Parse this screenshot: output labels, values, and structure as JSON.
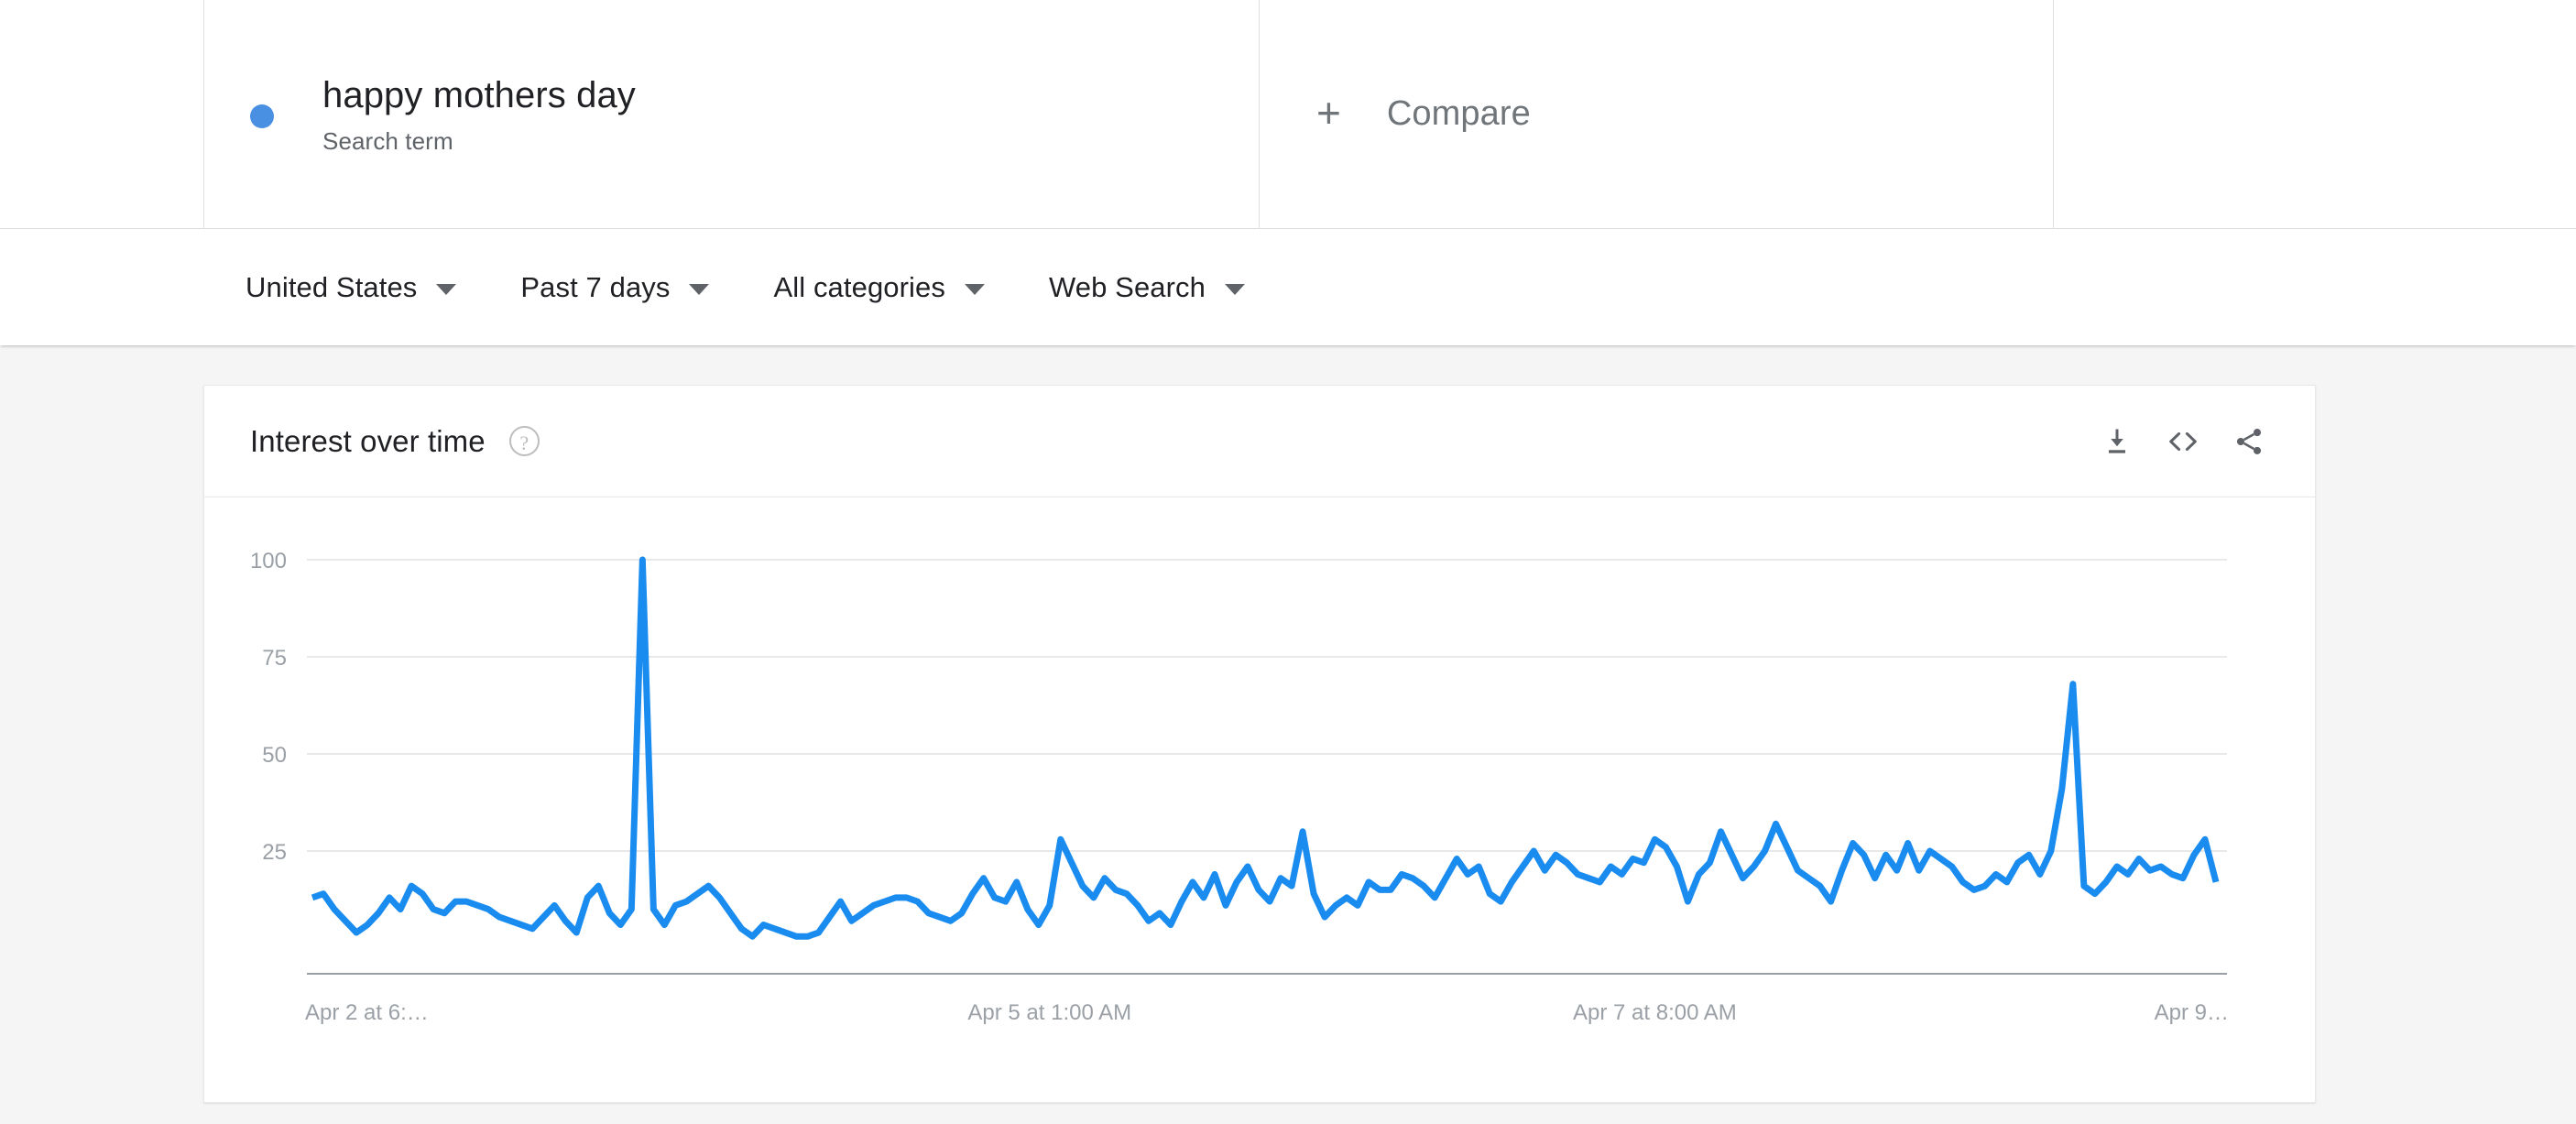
{
  "term": {
    "name": "happy mothers day",
    "type_label": "Search term",
    "dot_color": "#4a90e2"
  },
  "compare": {
    "plus_glyph": "+",
    "label": "Compare"
  },
  "filters": [
    {
      "label": "United States"
    },
    {
      "label": "Past 7 days"
    },
    {
      "label": "All categories"
    },
    {
      "label": "Web Search"
    }
  ],
  "card": {
    "title": "Interest over time",
    "help_glyph": "?",
    "actions": [
      {
        "name": "download-icon"
      },
      {
        "name": "embed-icon"
      },
      {
        "name": "share-icon"
      }
    ]
  },
  "chart_data": {
    "type": "line",
    "title": "Interest over time",
    "xlabel": "",
    "ylabel": "",
    "ylim": [
      0,
      100
    ],
    "grid": true,
    "legend_position": "top",
    "line_color": "#1a8cf0",
    "yticks": [
      100,
      75,
      50,
      25
    ],
    "xticks": [
      {
        "label": "Apr 2 at 6:…",
        "index": 0
      },
      {
        "label": "Apr 5 at 1:00 AM",
        "index": 67
      },
      {
        "label": "Apr 7 at 8:00 AM",
        "index": 122
      },
      {
        "label": "Apr 9…",
        "index": 167
      }
    ],
    "series": [
      {
        "name": "happy mothers day",
        "values": [
          13,
          14,
          10,
          7,
          4,
          6,
          9,
          13,
          10,
          16,
          14,
          10,
          9,
          12,
          12,
          11,
          10,
          8,
          7,
          6,
          5,
          8,
          11,
          7,
          4,
          13,
          16,
          9,
          6,
          10,
          100,
          10,
          6,
          11,
          12,
          14,
          16,
          13,
          9,
          5,
          3,
          6,
          5,
          4,
          3,
          3,
          4,
          8,
          12,
          7,
          9,
          11,
          12,
          13,
          13,
          12,
          9,
          8,
          7,
          9,
          14,
          18,
          13,
          12,
          17,
          10,
          6,
          11,
          28,
          22,
          16,
          13,
          18,
          15,
          14,
          11,
          7,
          9,
          6,
          12,
          17,
          13,
          19,
          11,
          17,
          21,
          15,
          12,
          18,
          16,
          30,
          14,
          8,
          11,
          13,
          11,
          17,
          15,
          15,
          19,
          18,
          16,
          13,
          18,
          23,
          19,
          21,
          14,
          12,
          17,
          21,
          25,
          20,
          24,
          22,
          19,
          18,
          17,
          21,
          19,
          23,
          22,
          28,
          26,
          21,
          12,
          19,
          22,
          30,
          24,
          18,
          21,
          25,
          32,
          26,
          20,
          18,
          16,
          12,
          20,
          27,
          24,
          18,
          24,
          20,
          27,
          20,
          25,
          23,
          21,
          17,
          15,
          16,
          19,
          17,
          22,
          24,
          19,
          25,
          41,
          68,
          16,
          14,
          17,
          21,
          19,
          23,
          20,
          21,
          19,
          18,
          24,
          28,
          17
        ]
      }
    ]
  }
}
